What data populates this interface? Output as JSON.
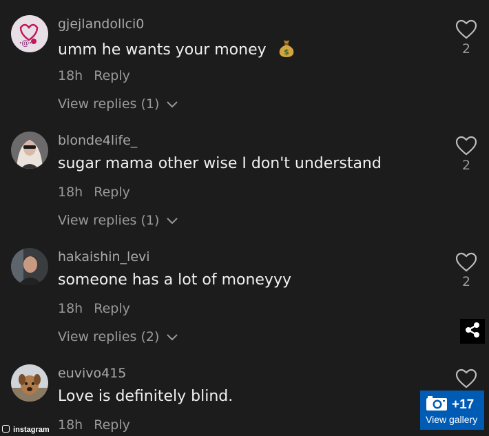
{
  "comments": [
    {
      "username": "gjejlandollci0",
      "text": "umm he wants your money",
      "emoji": "money-bag",
      "time": "18h",
      "reply_label": "Reply",
      "view_replies": "View replies (1)",
      "likes": "2"
    },
    {
      "username": "blonde4life_",
      "text": "sugar mama other wise I don't understand",
      "time": "18h",
      "reply_label": "Reply",
      "view_replies": "View replies (1)",
      "likes": "2"
    },
    {
      "username": "hakaishin_levi",
      "text": "someone has a lot of moneyyy",
      "time": "18h",
      "reply_label": "Reply",
      "view_replies": "View replies (2)",
      "likes": "2"
    },
    {
      "username": "euvivo415",
      "text": "Love is definitely blind.",
      "time": "18h",
      "reply_label": "Reply"
    }
  ],
  "gallery": {
    "count": "+17",
    "label": "View gallery"
  },
  "watermark": {
    "text": "instagram"
  },
  "icons": {
    "like": "heart-outline-icon",
    "share": "share-icon",
    "camera": "camera-icon",
    "chevron": "chevron-down-icon"
  },
  "colors": {
    "background": "#1c1c1c",
    "gallery_blue": "#005bb5",
    "muted_text": "#9a9a9a"
  }
}
